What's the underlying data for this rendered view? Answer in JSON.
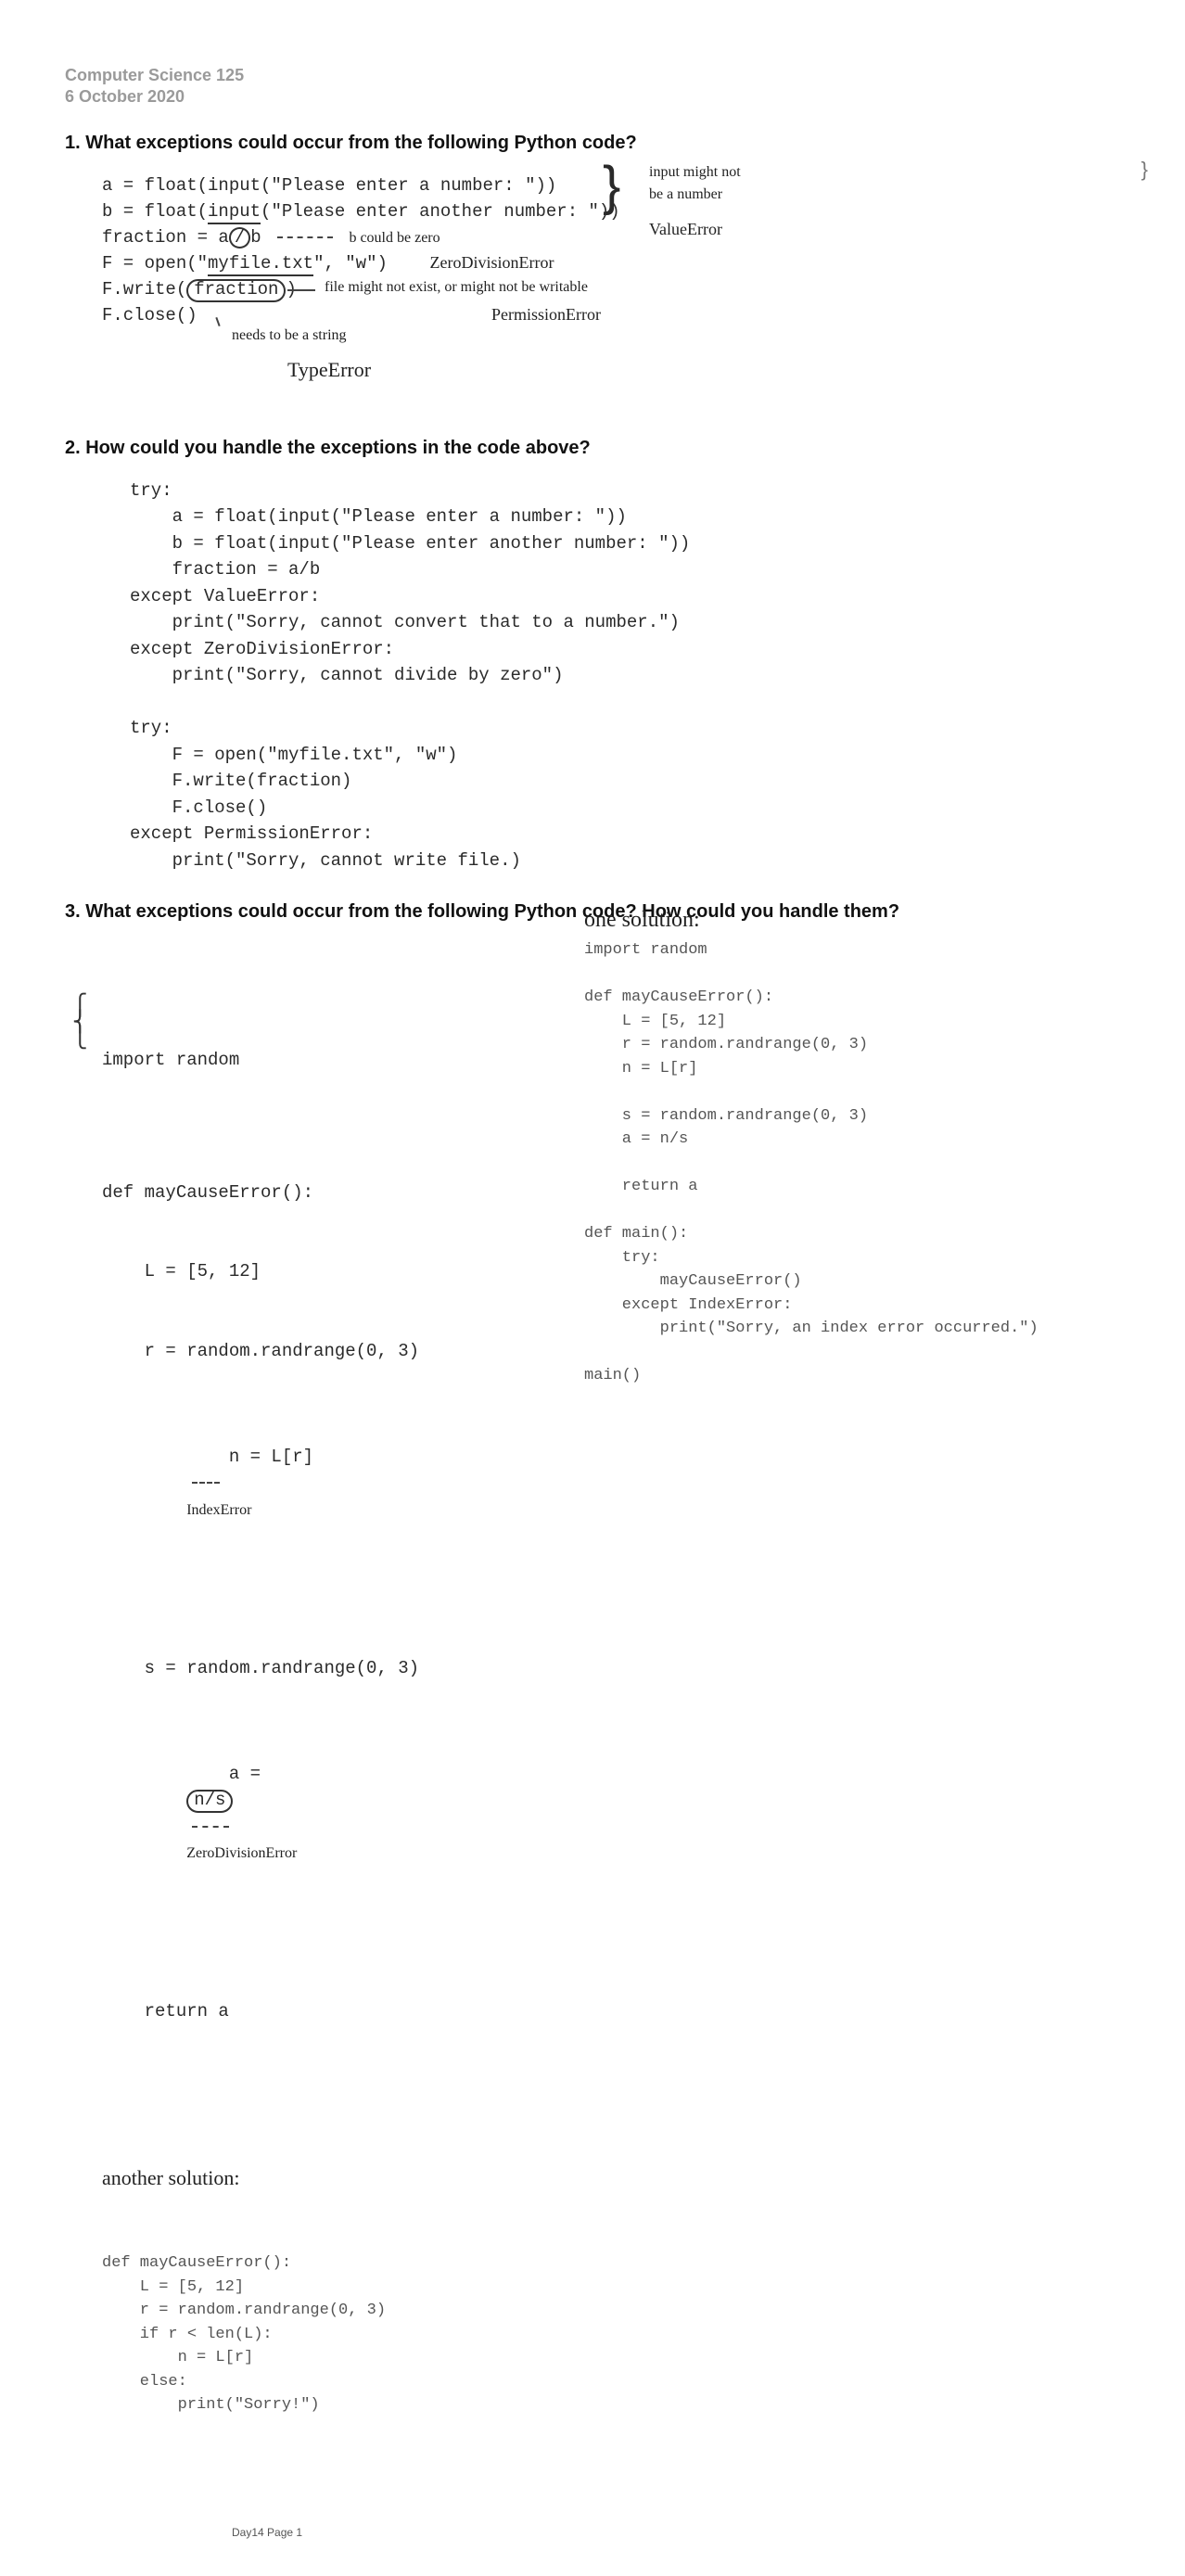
{
  "header": {
    "course": "Computer Science 125",
    "date": "6 October 2020"
  },
  "q1": {
    "heading": "1. What exceptions could occur from the following Python code?",
    "lines": {
      "l1a": "a = float(input(\"Please enter a number: \"))",
      "l2a": "b = float(",
      "l2b": "input",
      "l2c": "(\"Please enter another number: \"))",
      "l3a": "fraction = a",
      "l3b": "/",
      "l3c": "b",
      "l3tail": "b  could  be  zero",
      "l4a": "F = open(\"",
      "l4b": "myfile.txt",
      "l4c": "\", \"w\")",
      "l5a": "F.write(",
      "l5b": "fraction",
      "l5c": ")",
      "l6": "F.close()"
    },
    "annotations": {
      "brace_note": "input might not\nbe a number",
      "value_error": "ValueError",
      "zero_div": "ZeroDivisionError",
      "file_note": "file might not exist, or might not be writable",
      "perm_err": "PermissionError",
      "needs_string": "needs to be a string",
      "type_error": "TypeError"
    }
  },
  "q2": {
    "heading": "2. How could you handle the exceptions in the code above?",
    "code": "try:\n    a = float(input(\"Please enter a number: \"))\n    b = float(input(\"Please enter another number: \"))\n    fraction = a/b\nexcept ValueError:\n    print(\"Sorry, cannot convert that to a number.\")\nexcept ZeroDivisionError:\n    print(\"Sorry, cannot divide by zero\")\n\ntry:\n    F = open(\"myfile.txt\", \"w\")\n    F.write(fraction)\n    F.close()\nexcept PermissionError:\n    print(\"Sorry, cannot write file.)"
  },
  "q3": {
    "heading": "3. What exceptions could occur from the following Python code? How could you handle them?",
    "one_solution": "one solution:",
    "left": {
      "import": "import random",
      "def": "def mayCauseError():",
      "l1": "    L = [5, 12]",
      "l2": "    r = random.randrange(0, 3)",
      "l3a": "    n = L[r]",
      "l3note": "IndexError",
      "l4": "    s = random.randrange(0, 3)",
      "l5a": "    a =",
      "l5b": "n/s",
      "l5note": "ZeroDivisionError",
      "l6": "    return a"
    },
    "another_solution": "another solution:",
    "alt_code": "def mayCauseError():\n    L = [5, 12]\n    r = random.randrange(0, 3)\n    if r < len(L):\n        n = L[r]\n    else:\n        print(\"Sorry!\")",
    "right_code": "import random\n\ndef mayCauseError():\n    L = [5, 12]\n    r = random.randrange(0, 3)\n    n = L[r]\n\n    s = random.randrange(0, 3)\n    a = n/s\n\n    return a\n\ndef main():\n    try:\n        mayCauseError()\n    except IndexError:\n        print(\"Sorry, an index error occurred.\")\n\nmain()"
  },
  "footer": "Day14 Page 1",
  "edge_mark": "}"
}
